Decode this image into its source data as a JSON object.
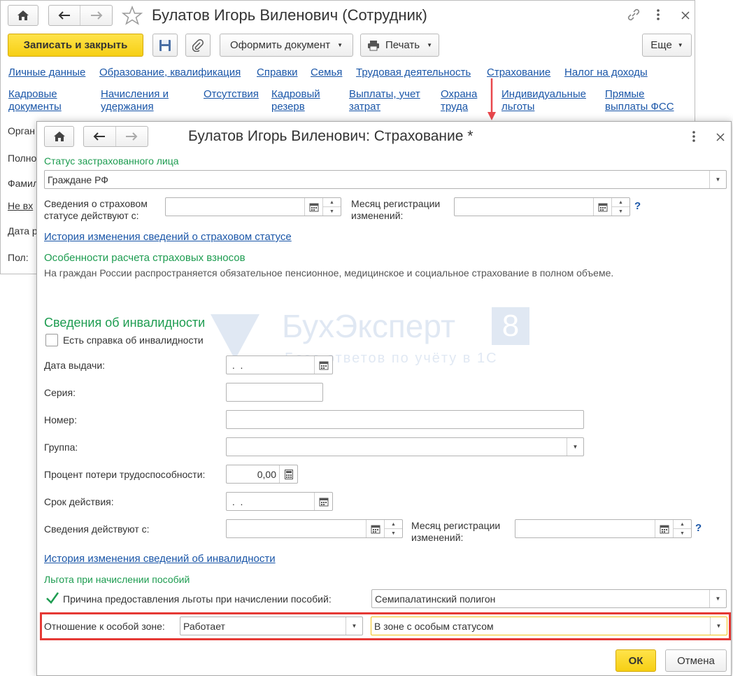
{
  "back_window": {
    "title": "Булатов Игорь Виленович (Сотрудник)",
    "toolbar": {
      "save_close": "Записать и закрыть",
      "create_doc": "Оформить документ",
      "print": "Печать",
      "more": "Еще"
    },
    "tabs_row1": [
      "Личные данные",
      "Образование, квалификация",
      "Справки",
      "Семья",
      "Трудовая деятельность",
      "Страхование",
      "Налог на доходы"
    ],
    "tabs_row2": [
      {
        "l1": "Кадровые",
        "l2": "документы"
      },
      {
        "l1": "Начисления и",
        "l2": "удержания"
      },
      {
        "l1": "Отсутствия",
        "l2": ""
      },
      {
        "l1": "Кадровый",
        "l2": "резерв"
      },
      {
        "l1": "Выплаты, учет",
        "l2": "затрат"
      },
      {
        "l1": "Охрана",
        "l2": "труда"
      },
      {
        "l1": "Индивидуальные",
        "l2": "льготы"
      },
      {
        "l1": "Прямые",
        "l2": "выплаты ФСС"
      }
    ],
    "side_labels": [
      "Орган",
      "Полно",
      "Фамил",
      "Не вх",
      "Дата р",
      "Пол:"
    ]
  },
  "dialog": {
    "title": "Булатов Игорь Виленович: Страхование *",
    "insured_status_header": "Статус застрахованного лица",
    "insured_status_value": "Граждане РФ",
    "status_effective_label_1": "Сведения о страховом",
    "status_effective_label_2": "статусе действуют с:",
    "reg_month_label_1": "Месяц регистрации",
    "reg_month_label_2": "изменений:",
    "history_status_link": "История изменения сведений о страховом статусе",
    "contrib_header": "Особенности расчета страховых взносов",
    "contrib_text": "На граждан России распространяется обязательное пенсионное, медицинское и социальное страхование в полном объеме.",
    "disability_header": "Сведения об инвалидности",
    "has_certificate": "Есть справка об инвалидности",
    "issue_date_label": "Дата выдачи:",
    "issue_date_value": " .  .",
    "series_label": "Серия:",
    "number_label": "Номер:",
    "group_label": "Группа:",
    "loss_percent_label": "Процент потери трудоспособности:",
    "loss_percent_value": "0,00",
    "validity_label": "Срок действия:",
    "validity_value": " .  .",
    "effective_from_label": "Сведения действуют с:",
    "reg_month2_label_1": "Месяц регистрации",
    "reg_month2_label_2": "изменений:",
    "history_disability_link": "История изменения сведений об инвалидности",
    "benefit_header": "Льгота при начислении пособий",
    "benefit_reason_label": "Причина предоставления льготы при начислении пособий:",
    "benefit_reason_value": "Семипалатинский полигон",
    "zone_label": "Отношение к особой зоне:",
    "zone_relation_value": "Работает",
    "zone_status_value": "В зоне с особым статусом",
    "ok": "ОК",
    "cancel": "Отмена",
    "question_mark": "?"
  },
  "watermark": {
    "brand": "БухЭксперт",
    "brand_num": "8",
    "tagline": "База ответов по учёту в 1С"
  },
  "colors": {
    "link": "#1a56a8",
    "section_green": "#1d9c50",
    "primary_yellow": "#f6cf14",
    "highlight_red": "#e53935",
    "arrow_red": "#e8474c"
  }
}
